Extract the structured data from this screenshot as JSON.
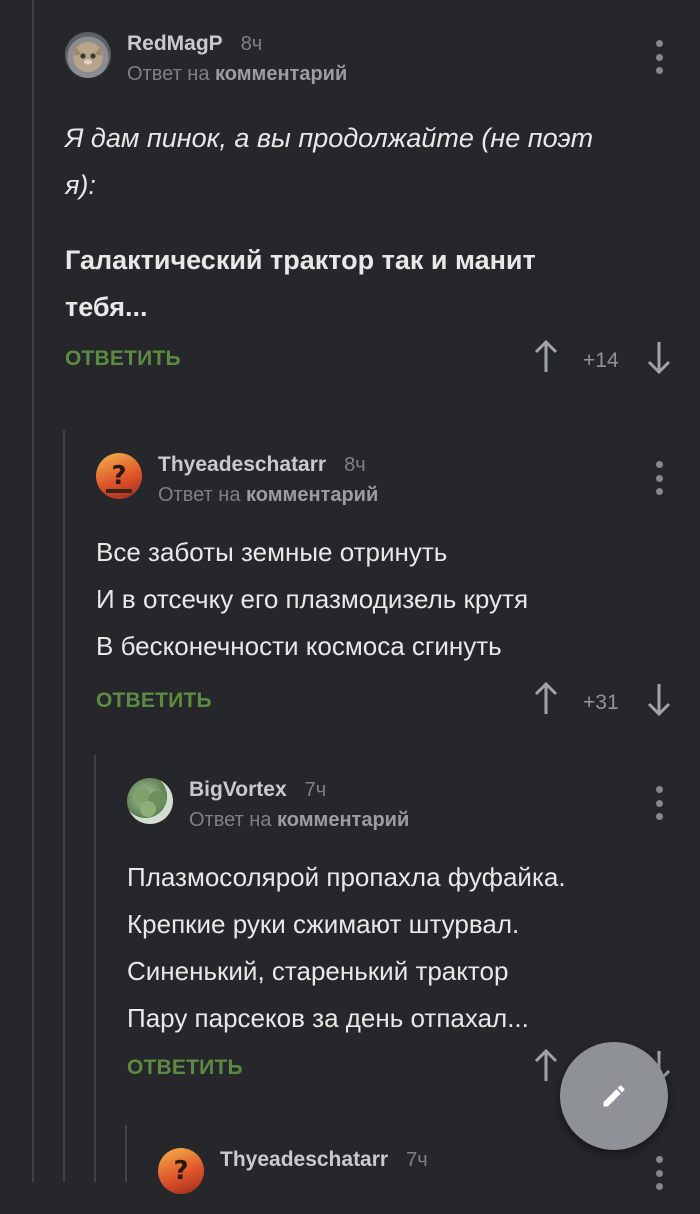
{
  "comments": [
    {
      "author": "RedMagP",
      "time": "8ч",
      "reply_prefix": "Ответ на",
      "reply_target": "комментарий",
      "lines": [
        "Я дам пинок, а вы продолжайте (не поэт",
        "я):"
      ],
      "bold_lines": [
        "Галактический трактор так и манит",
        "тебя..."
      ],
      "reply_label": "ОТВЕТИТЬ",
      "score": "+14"
    },
    {
      "author": "Thyeadeschatarr",
      "time": "8ч",
      "reply_prefix": "Ответ на",
      "reply_target": "комментарий",
      "lines": [
        "Все заботы земные отринуть",
        "И в отсечку его плазмодизель крутя",
        "В бесконечности космоса сгинуть"
      ],
      "reply_label": "ОТВЕТИТЬ",
      "score": "+31"
    },
    {
      "author": "BigVortex",
      "time": "7ч",
      "reply_prefix": "Ответ на",
      "reply_target": "комментарий",
      "lines": [
        "Плазмосолярой пропахла фуфайка.",
        "Крепкие руки сжимают штурвал.",
        "Синенький, старенький трактор",
        "Пару парсеков за день отпахал..."
      ],
      "reply_label": "ОТВЕТИТЬ",
      "score": ""
    },
    {
      "author": "Thyeadeschatarr",
      "time": "7ч"
    }
  ],
  "colors": {
    "background": "#25272a",
    "accent_green": "#5d8a41",
    "thread_line": "#3f4246",
    "fab": "#8e9195"
  },
  "icons": {
    "upvote": "arrow-up-icon",
    "downvote": "arrow-down-icon",
    "menu": "more-vertical-icon",
    "fab": "pencil-icon"
  }
}
